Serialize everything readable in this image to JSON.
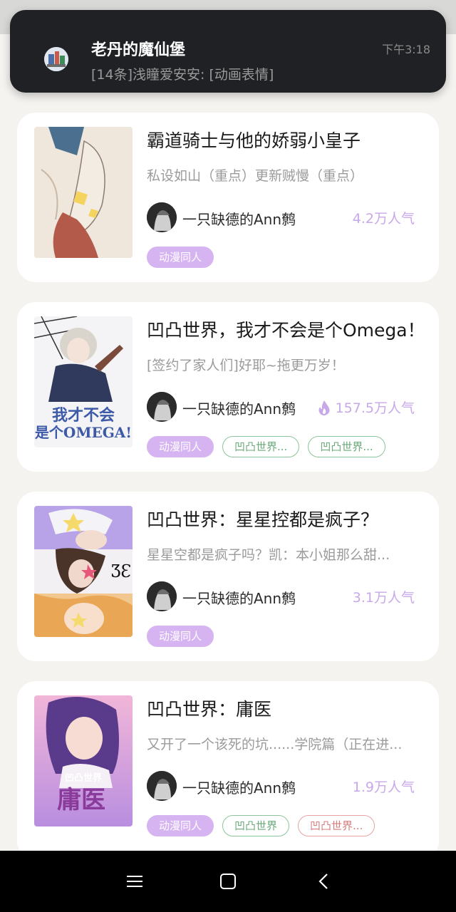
{
  "notification": {
    "app_title": "老丹的魔仙堡",
    "message": "[14条]浅瞳爱安安: [动画表情]",
    "time": "下午3:18",
    "icon": "group-avatar-icon"
  },
  "books": [
    {
      "title": "霸道骑士与他的娇弱小皇子",
      "description": "私设如山（重点）更新贼慢（重点）",
      "author": "一只缺德的Ann鹩",
      "popularity": "4.2万人气",
      "hot": false,
      "tags": [
        {
          "label": "动漫同人",
          "style": "purple"
        }
      ]
    },
    {
      "title": "凹凸世界，我才不会是个Omega！",
      "description": "[签约了家人们]好耶~拖更万岁！",
      "author": "一只缺德的Ann鹩",
      "popularity": "157.5万人气",
      "hot": true,
      "cover_text": "我才不会是个OMEGA!",
      "tags": [
        {
          "label": "动漫同人",
          "style": "purple"
        },
        {
          "label": "凹凸世界...",
          "style": "green"
        },
        {
          "label": "凹凸世界...",
          "style": "green"
        }
      ]
    },
    {
      "title": "凹凸世界：星星控都是疯子？",
      "description": "星星空都是疯子吗？凯：本小姐那么甜...",
      "author": "一只缺德的Ann鹩",
      "popularity": "3.1万人气",
      "hot": false,
      "tags": [
        {
          "label": "动漫同人",
          "style": "purple"
        }
      ]
    },
    {
      "title": "凹凸世界：庸医",
      "description": "又开了一个该死的坑......学院篇（正在进...",
      "author": "一只缺德的Ann鹩",
      "popularity": "1.9万人气",
      "hot": false,
      "cover_text": "凹凸世界 庸医",
      "tags": [
        {
          "label": "动漫同人",
          "style": "purple"
        },
        {
          "label": "凹凸世界",
          "style": "green"
        },
        {
          "label": "凹凸世界...",
          "style": "red"
        }
      ]
    }
  ],
  "navbar": {
    "menu_icon": "menu-icon",
    "home_icon": "home-square-icon",
    "back_icon": "back-chevron-icon"
  },
  "colors": {
    "popularity": "#c9a8ea",
    "tag_purple": "#d6b3f1",
    "tag_green": "#8cc49b",
    "tag_red": "#e7a3a3"
  }
}
